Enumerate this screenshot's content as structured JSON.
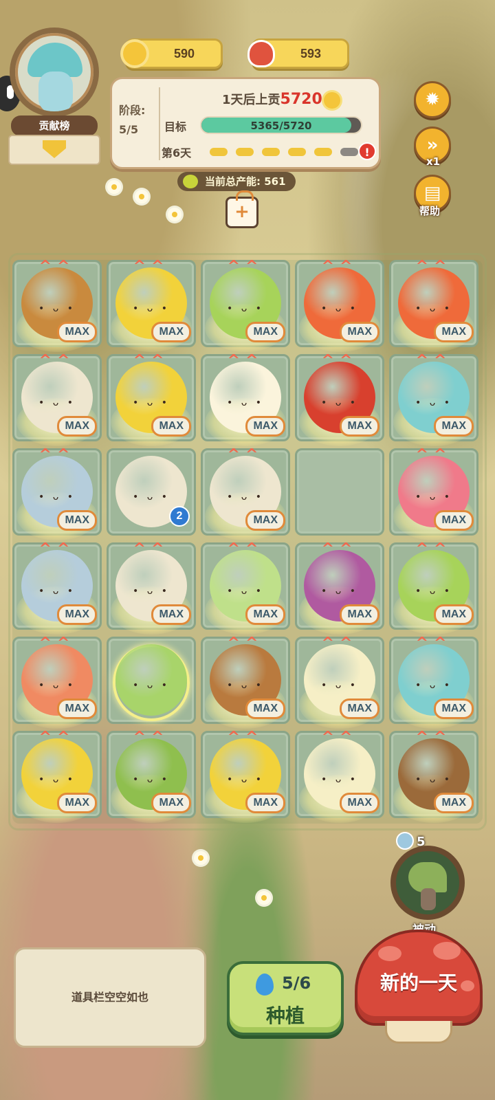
{
  "resources": {
    "sun": {
      "value": "590",
      "icon": "sun-icon"
    },
    "mushroom": {
      "value": "593",
      "icon": "mushroom-icon"
    }
  },
  "rank": {
    "label": "贡献榜"
  },
  "stage": {
    "label": "阶段:",
    "value": "5/5",
    "tribute_prefix": "1天后上贡",
    "tribute_amount": "5720",
    "goal_label": "目标",
    "goal_text": "5365/5720",
    "goal_progress": 0.938,
    "day_label": "第6天",
    "days_filled": 6,
    "days_total": 7,
    "warn": "!"
  },
  "capacity": {
    "label": "当前总产能:",
    "value": "561"
  },
  "side_buttons": {
    "settings": {
      "icon": "gear-icon"
    },
    "speed": {
      "icon": "fast-forward-icon",
      "label": "x1"
    },
    "help": {
      "icon": "book-icon",
      "label": "帮助"
    }
  },
  "grid": {
    "max_label": "MAX",
    "cells": [
      {
        "plant": "brown-mushroom",
        "color": "#c98a3e",
        "max": true
      },
      {
        "plant": "durian",
        "color": "#f2d23a",
        "max": true
      },
      {
        "plant": "broccoli",
        "color": "#a7d35a",
        "max": true
      },
      {
        "plant": "red-pepper",
        "color": "#ef6a3a",
        "max": true
      },
      {
        "plant": "red-pepper",
        "color": "#ef6a3a",
        "max": true
      },
      {
        "plant": "enoki-mushroom",
        "color": "#eee6cf",
        "max": true
      },
      {
        "plant": "durian",
        "color": "#f2d23a",
        "max": true
      },
      {
        "plant": "radish",
        "color": "#fbf4dc",
        "max": true
      },
      {
        "plant": "red-pepper",
        "color": "#d8402e",
        "max": true
      },
      {
        "plant": "teal-mushroom",
        "color": "#7fcfcf",
        "max": true
      },
      {
        "plant": "veiled-mushroom",
        "color": "#b5cddb",
        "max": true
      },
      {
        "plant": "enoki-mushroom",
        "color": "#eee6cf",
        "max": false,
        "level": "2"
      },
      {
        "plant": "enoki-mushroom",
        "color": "#eee6cf",
        "max": true
      },
      {
        "plant": "",
        "color": "",
        "max": false
      },
      {
        "plant": "dragon-fruit",
        "color": "#f07a8a",
        "max": true
      },
      {
        "plant": "veiled-mushroom",
        "color": "#b5cddb",
        "max": true
      },
      {
        "plant": "enoki-mushroom",
        "color": "#eee6cf",
        "max": true
      },
      {
        "plant": "bok-choy",
        "color": "#bfe08a",
        "max": true
      },
      {
        "plant": "purple-mushroom",
        "color": "#b05aa0",
        "max": true
      },
      {
        "plant": "broccoli",
        "color": "#a7d35a",
        "max": true
      },
      {
        "plant": "peach",
        "color": "#f08a62",
        "max": true
      },
      {
        "plant": "pear",
        "color": "#a8d46a",
        "max": false
      },
      {
        "plant": "brown-mushroom",
        "color": "#b97a3e",
        "max": true
      },
      {
        "plant": "enoki-mushroom",
        "color": "#f6efc6",
        "max": true
      },
      {
        "plant": "teal-mushroom",
        "color": "#7fcfcf",
        "max": true
      },
      {
        "plant": "pineapple",
        "color": "#f2d23a",
        "max": true
      },
      {
        "plant": "broccoli",
        "color": "#8fbf4e",
        "max": true
      },
      {
        "plant": "durian",
        "color": "#f2d23a",
        "max": true
      },
      {
        "plant": "enoki-mushroom",
        "color": "#f6efc6",
        "max": true
      },
      {
        "plant": "brown-mushroom",
        "color": "#9b6a3a",
        "max": true
      }
    ]
  },
  "passive": {
    "count": "5",
    "label": "被动"
  },
  "inventory": {
    "empty_text": "道具栏空空如也"
  },
  "plant_button": {
    "water": "5/6",
    "label": "种植"
  },
  "new_day_button": {
    "label": "新的一天"
  },
  "colors": {
    "accent_red": "#d9352b",
    "progress_teal": "#5cc9a0",
    "gold": "#f7d65a"
  }
}
